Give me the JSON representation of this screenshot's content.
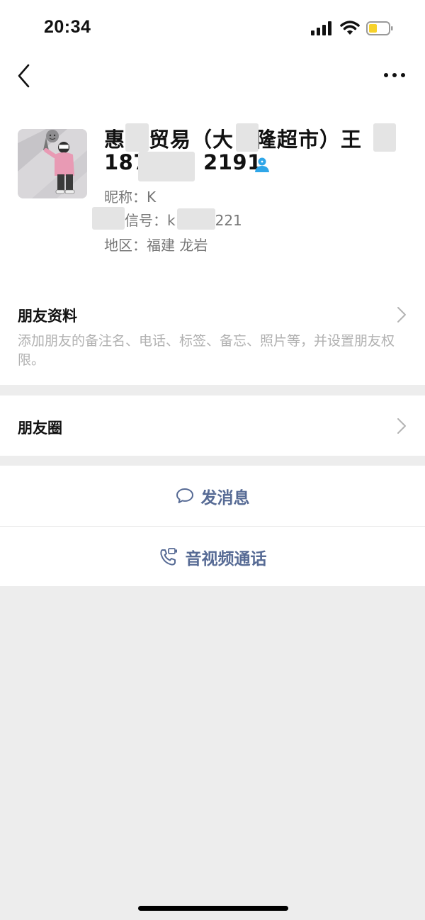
{
  "status_bar": {
    "time": "20:34"
  },
  "contact": {
    "name_parts": [
      "惠",
      "贸易（大",
      "隆超市）王"
    ],
    "phone_parts": [
      "187",
      "2191"
    ],
    "nickname_label": "昵称：",
    "nickname": "K",
    "wechat_id_label": "信号：",
    "wechat_id_start": "k",
    "wechat_id_end": "221",
    "region_label": "地区：",
    "region": "福建 龙岩"
  },
  "friend_info": {
    "title": "朋友资料",
    "subtitle": "添加朋友的备注名、电话、标签、备忘、照片等，并设置朋友权限。"
  },
  "moments": {
    "title": "朋友圈"
  },
  "actions": {
    "message": "发消息",
    "call": "音视频通话"
  },
  "colors": {
    "link_blue": "#576b95",
    "badge_blue": "#2fa6e8",
    "battery_yellow": "#f7d22b"
  },
  "icons": [
    "signal-icon",
    "wifi-icon",
    "battery-icon",
    "back-icon",
    "more-icon",
    "user-badge-icon",
    "chevron-right-icon",
    "chat-bubble-icon",
    "video-call-icon"
  ]
}
